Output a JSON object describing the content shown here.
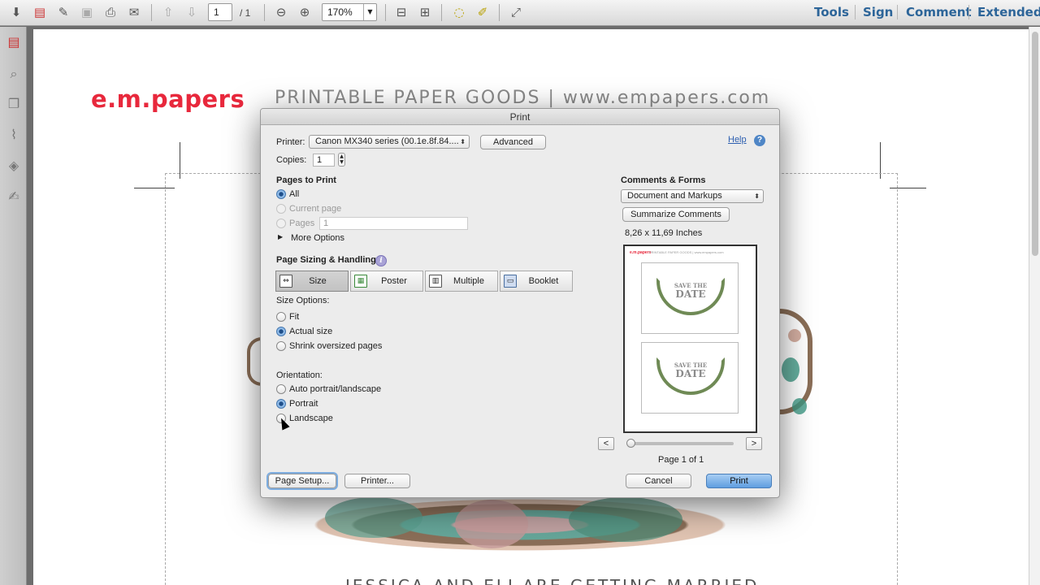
{
  "toolbar": {
    "page_current": "1",
    "page_total": "/ 1",
    "zoom": "170%",
    "links": [
      "Tools",
      "Sign",
      "Comment",
      "Extended"
    ],
    "icons": [
      "create-icon",
      "convert-icon",
      "edit-icon",
      "save-icon",
      "print-icon",
      "email-icon",
      "prev-page-icon",
      "next-page-icon",
      "zoom-out-icon",
      "zoom-in-icon",
      "fit-page-icon",
      "fit-width-icon",
      "comment-icon",
      "highlight-icon",
      "fullscreen-icon"
    ]
  },
  "sidebar": {
    "icons": [
      "pdf-icon",
      "search-icon",
      "pages-icon",
      "attachment-icon",
      "layers-icon",
      "signature-icon"
    ]
  },
  "document": {
    "logo": "e.m.papers",
    "tagline": "PRINTABLE PAPER GOODS | www.empapers.com",
    "bottom_text": "JESSICA AND ELI ARE GETTING MARRIED"
  },
  "dialog": {
    "title": "Print",
    "printer_label": "Printer:",
    "printer_value": "Canon MX340 series (00.1e.8f.84....",
    "advanced_button": "Advanced",
    "help_link": "Help",
    "copies_label": "Copies:",
    "copies_value": "1",
    "pages_to_print_label": "Pages to Print",
    "pages_options": [
      "All",
      "Current page",
      "Pages"
    ],
    "pages_range_value": "1",
    "more_options": "More Options",
    "page_sizing_label": "Page Sizing & Handling",
    "sizing_tabs": [
      "Size",
      "Poster",
      "Multiple",
      "Booklet"
    ],
    "size_options_label": "Size Options:",
    "size_options": [
      "Fit",
      "Actual size",
      "Shrink oversized pages"
    ],
    "orientation_label": "Orientation:",
    "orientation_options": [
      "Auto portrait/landscape",
      "Portrait",
      "Landscape"
    ],
    "comments_forms_label": "Comments & Forms",
    "comments_forms_value": "Document and Markups",
    "summarize_button": "Summarize Comments",
    "paper_size": "8,26 x 11,69 Inches",
    "preview_prev": "<",
    "preview_next": ">",
    "preview_page": "Page 1 of 1",
    "preview_card_title_1": "SAVE THE",
    "preview_card_title_2": "DATE",
    "preview_logo": "e.m.papers",
    "preview_tag": "PRINTABLE PAPER GOODS | www.empapers.com",
    "page_setup_button": "Page Setup...",
    "printer_button": "Printer...",
    "cancel_button": "Cancel",
    "print_button": "Print"
  },
  "colors": {
    "brand_red": "#e8283c",
    "link_blue": "#2d6599",
    "primary_button": "#5f9de0"
  }
}
